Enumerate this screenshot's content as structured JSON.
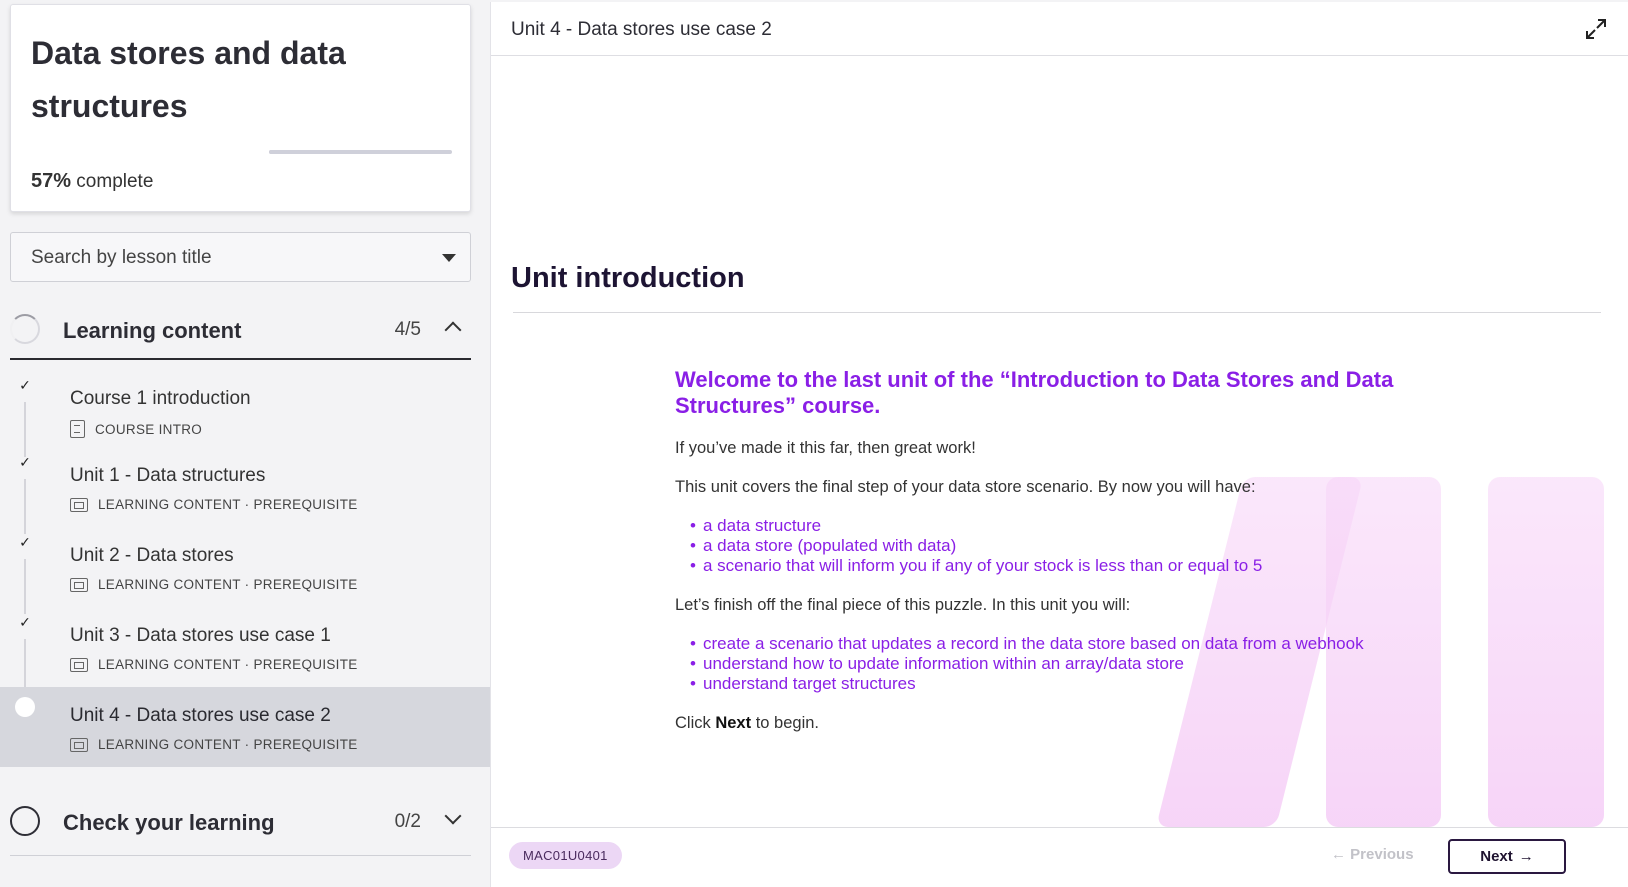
{
  "course": {
    "title": "Data stores and data structures",
    "progress_value": "57%",
    "progress_suffix": " complete",
    "progress_fraction": 0.57
  },
  "search": {
    "placeholder": "Search by lesson title"
  },
  "sections": [
    {
      "title": "Learning content",
      "count": "4/5",
      "expanded": true,
      "lessons": [
        {
          "title": "Course 1 introduction",
          "meta": "COURSE INTRO",
          "done": true,
          "icon": "document-icon"
        },
        {
          "title": "Unit 1 - Data structures",
          "meta": "LEARNING CONTENT · PREREQUISITE",
          "done": true,
          "icon": "slides-icon"
        },
        {
          "title": "Unit 2 - Data stores",
          "meta": "LEARNING CONTENT · PREREQUISITE",
          "done": true,
          "icon": "slides-icon"
        },
        {
          "title": "Unit 3 - Data stores use case 1",
          "meta": "LEARNING CONTENT · PREREQUISITE",
          "done": true,
          "icon": "slides-icon"
        },
        {
          "title": "Unit 4 - Data stores use case 2",
          "meta": "LEARNING CONTENT · PREREQUISITE",
          "done": false,
          "active": true,
          "icon": "slides-icon"
        }
      ]
    },
    {
      "title": "Check your learning",
      "count": "0/2",
      "expanded": false
    }
  ],
  "main": {
    "topbar_title": "Unit 4 - Data stores use case 2",
    "heading": "Unit introduction",
    "welcome": "Welcome to the last unit of the “Introduction to Data Stores and Data Structures” course.",
    "para1": "If you’ve made it this far, then great work!",
    "para2": "This unit covers the final step of your data store scenario. By now you will have:",
    "list1": [
      "a data structure",
      "a data store (populated with data)",
      "a scenario that will inform you if any of your stock is less than or equal to 5"
    ],
    "para3": "Let’s finish off the final piece of this puzzle. In this unit you will:",
    "list2": [
      "create a scenario that updates a record in the data store based on data from a webhook",
      "understand how to update information within an array/data store",
      "understand target structures"
    ],
    "para4_pre": "Click ",
    "para4_bold": "Next",
    "para4_post": " to begin."
  },
  "footer": {
    "code": "MAC01U0401",
    "prev_label": "Previous",
    "next_label": "Next"
  },
  "colors": {
    "accent_purple": "#8a1fe6",
    "heading_dark": "#1d1433",
    "badge_bg": "#ecd7f5"
  }
}
